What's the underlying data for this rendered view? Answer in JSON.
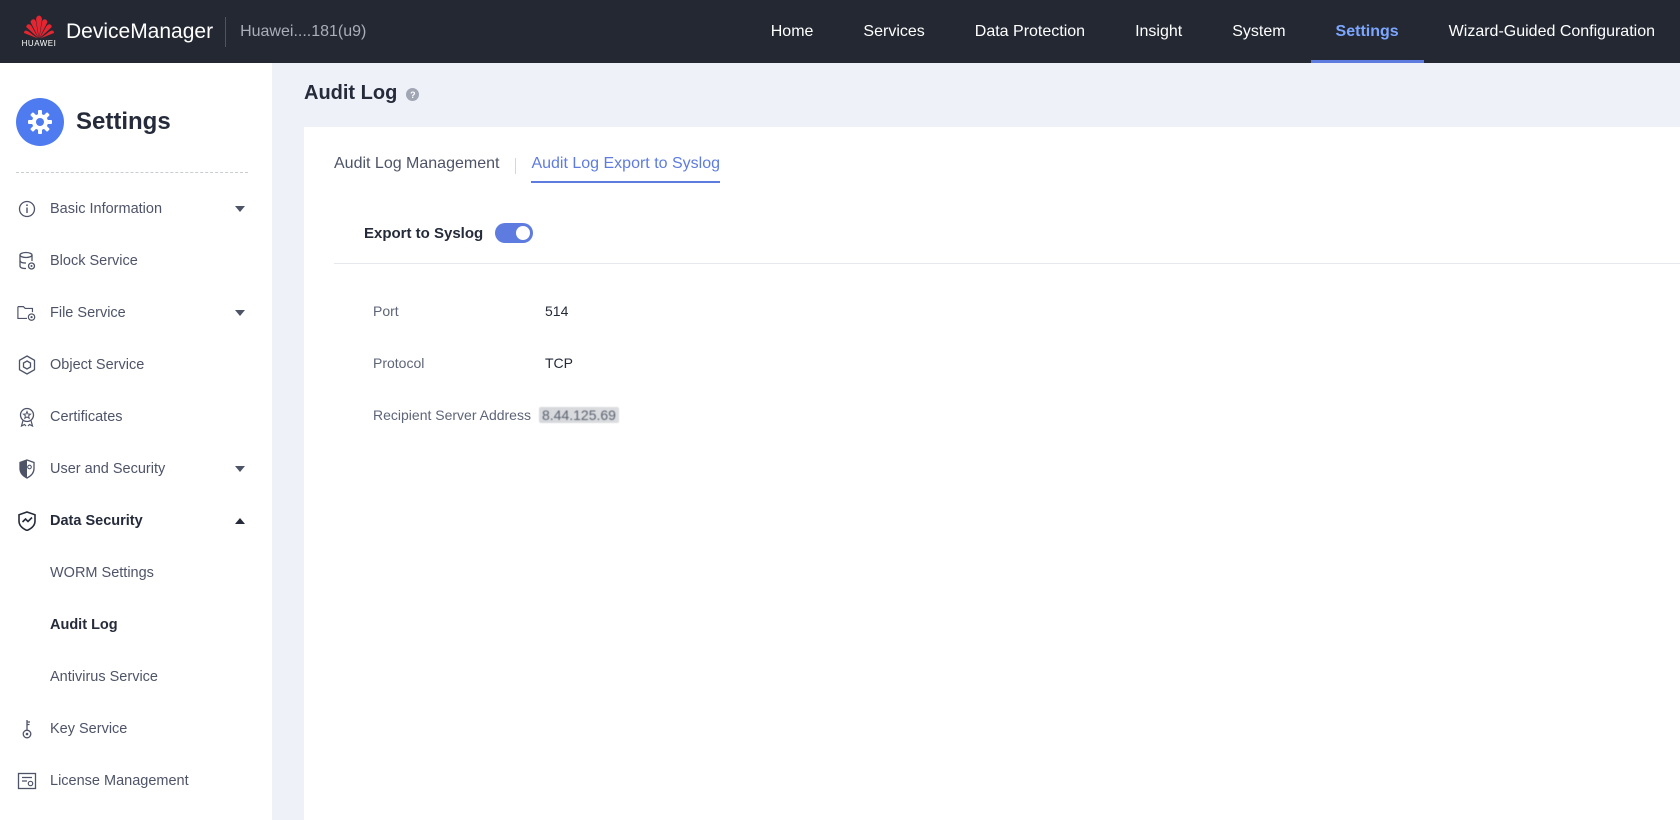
{
  "header": {
    "logo_text": "HUAWEI",
    "app_name": "DeviceManager",
    "device_name": "Huawei....181(u9)",
    "nav": [
      {
        "label": "Home"
      },
      {
        "label": "Services"
      },
      {
        "label": "Data Protection"
      },
      {
        "label": "Insight"
      },
      {
        "label": "System"
      },
      {
        "label": "Settings",
        "active": true
      },
      {
        "label": "Wizard-Guided Configuration"
      }
    ]
  },
  "sidebar": {
    "title": "Settings",
    "items": [
      {
        "label": "Basic Information",
        "icon": "info-icon",
        "expandable": true
      },
      {
        "label": "Block Service",
        "icon": "database-icon"
      },
      {
        "label": "File Service",
        "icon": "folder-gear-icon",
        "expandable": true
      },
      {
        "label": "Object Service",
        "icon": "hexagon-icon"
      },
      {
        "label": "Certificates",
        "icon": "badge-icon"
      },
      {
        "label": "User and Security",
        "icon": "shield-icon",
        "expandable": true
      },
      {
        "label": "Data Security",
        "icon": "shield-check-icon",
        "expanded": true
      },
      {
        "label": "WORM Settings",
        "sub": true
      },
      {
        "label": "Audit Log",
        "sub": true,
        "current": true
      },
      {
        "label": "Antivirus Service",
        "sub": true
      },
      {
        "label": "Key Service",
        "icon": "key-icon"
      },
      {
        "label": "License Management",
        "icon": "license-icon"
      }
    ]
  },
  "main": {
    "title": "Audit Log",
    "help_glyph": "?",
    "tabs": [
      {
        "label": "Audit Log Management"
      },
      {
        "label": "Audit Log Export to Syslog",
        "active": true
      }
    ],
    "export_label": "Export to Syslog",
    "export_enabled": true,
    "fields": {
      "port_label": "Port",
      "port_value": "514",
      "protocol_label": "Protocol",
      "protocol_value": "TCP",
      "address_label": "Recipient Server Address",
      "address_value": "8.44.125.69"
    }
  },
  "colors": {
    "topbar": "#232833",
    "accent": "#5e7ce0",
    "active_nav": "#7ca6ff",
    "page_bg": "#eef1f8"
  }
}
